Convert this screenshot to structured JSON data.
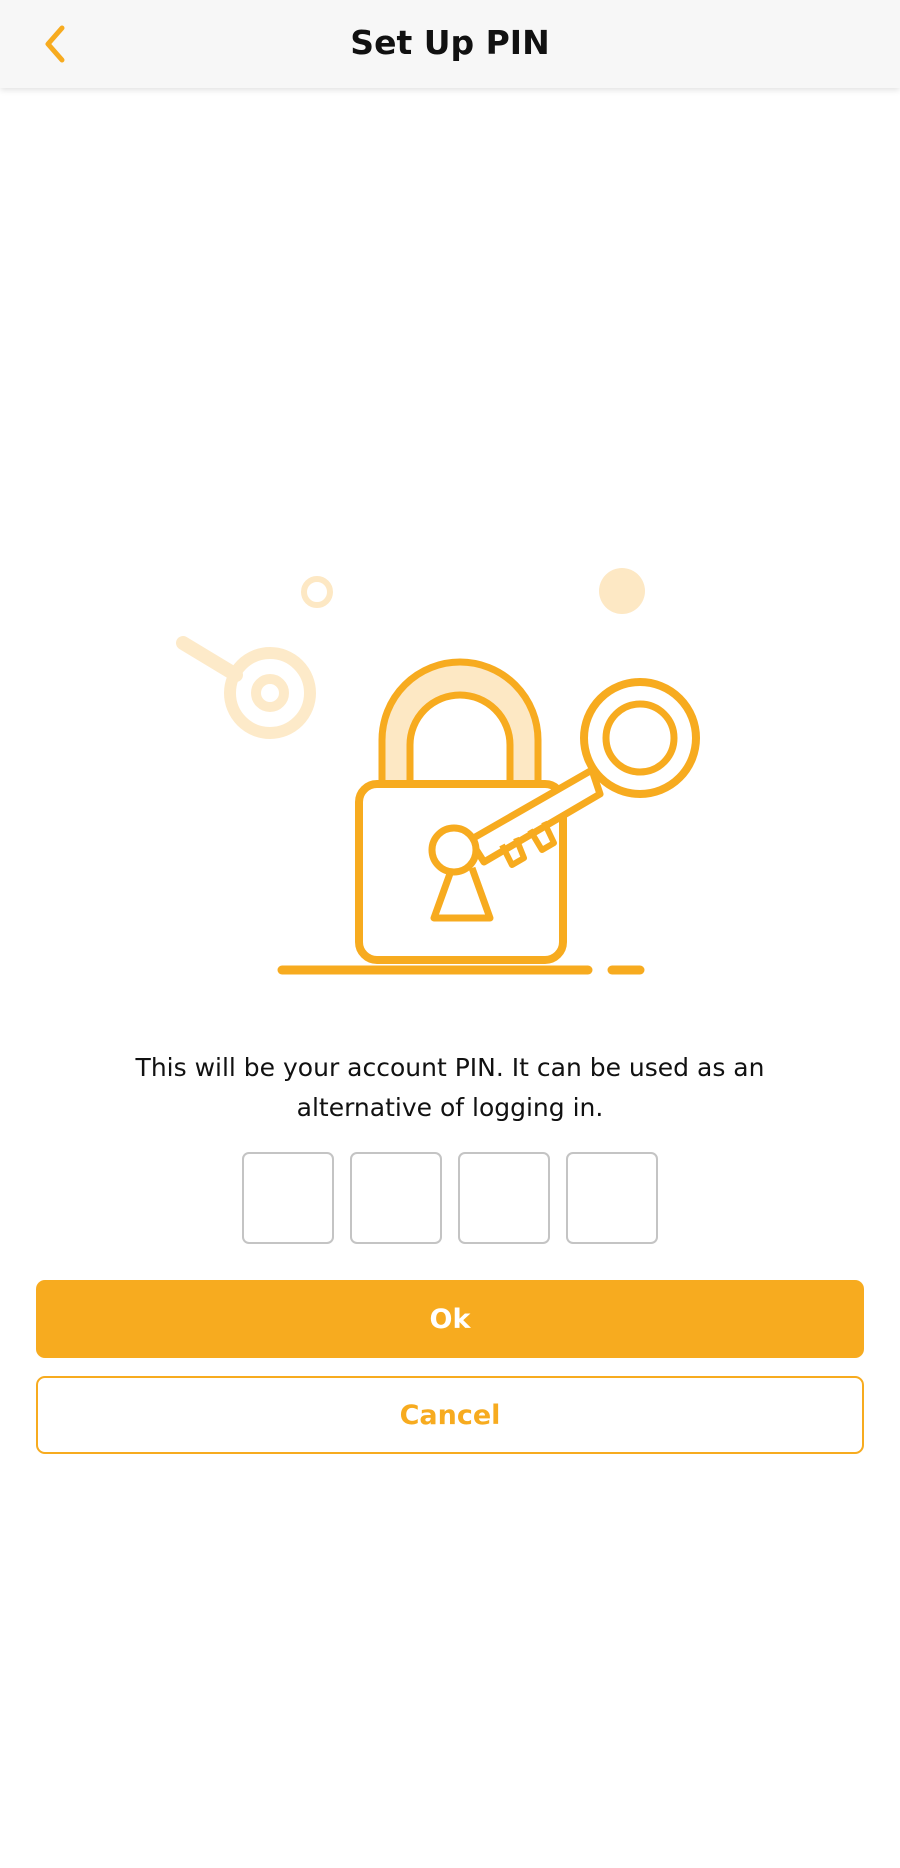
{
  "header": {
    "title": "Set Up PIN",
    "back_icon": "chevron-left-icon"
  },
  "illustration": {
    "name": "padlock-with-key",
    "icons": [
      "padlock-icon",
      "key-icon"
    ]
  },
  "message": {
    "text": "This will be your account PIN. It can be used as an alternative of logging in."
  },
  "pin": {
    "length": 4,
    "values": [
      "",
      "",
      "",
      ""
    ]
  },
  "buttons": {
    "ok_label": "Ok",
    "cancel_label": "Cancel"
  },
  "colors": {
    "accent": "#f7ab1f",
    "accent_light": "#fde8c4",
    "header_bg": "#f7f7f7",
    "border": "#c4c4c4",
    "text": "#111111"
  }
}
